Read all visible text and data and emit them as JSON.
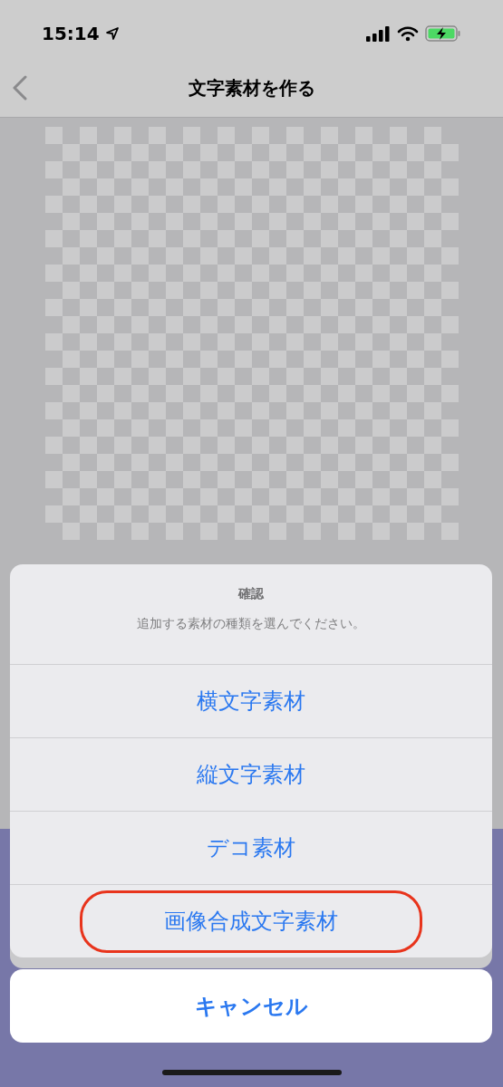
{
  "status_bar": {
    "time": "15:14"
  },
  "nav": {
    "title": "文字素材を作る"
  },
  "action_sheet": {
    "title": "確認",
    "message": "追加する素材の種類を選んでください。",
    "actions": [
      {
        "label": "横文字素材",
        "highlighted": false
      },
      {
        "label": "縦文字素材",
        "highlighted": false
      },
      {
        "label": "デコ素材",
        "highlighted": false
      },
      {
        "label": "画像合成文字素材",
        "highlighted": true
      }
    ],
    "cancel": "キャンセル"
  }
}
